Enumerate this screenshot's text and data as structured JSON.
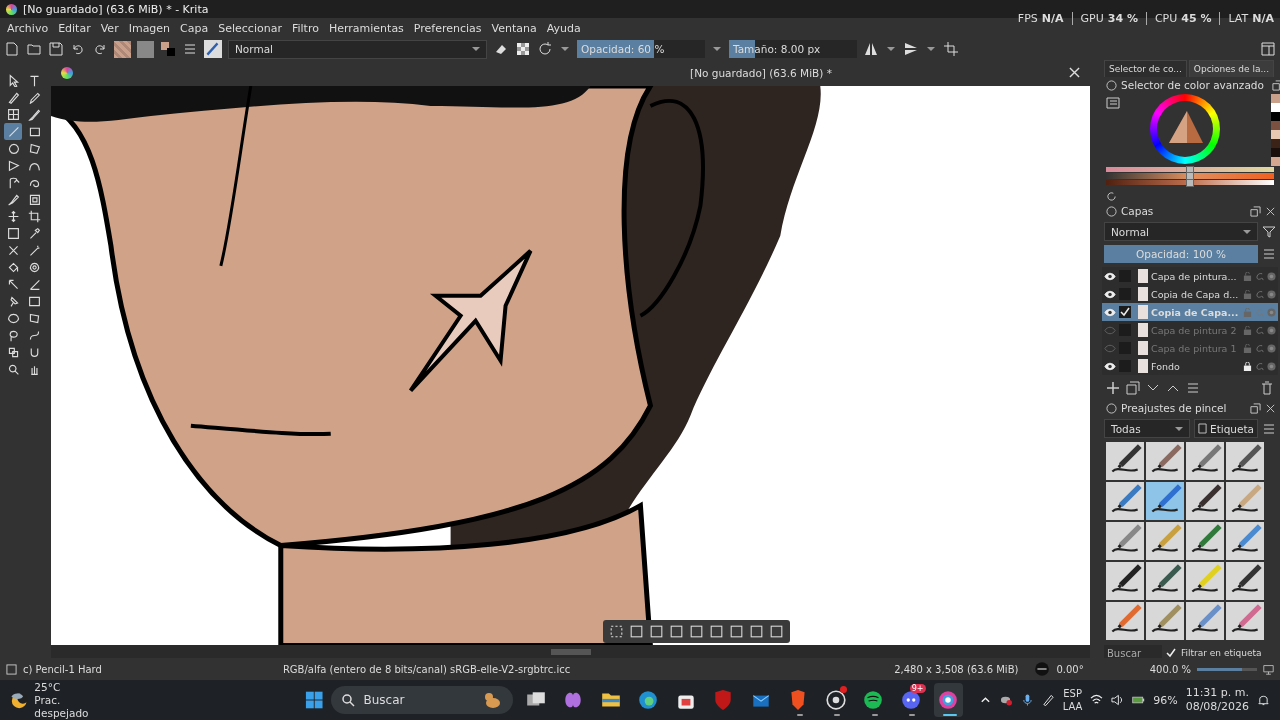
{
  "window": {
    "title": "[No guardado]  (63.6 MiB) * - Krita"
  },
  "perf": [
    {
      "label": "FPS",
      "value": "N/A"
    },
    {
      "label": "GPU",
      "value": "34 %"
    },
    {
      "label": "CPU",
      "value": "45 %"
    },
    {
      "label": "LAT",
      "value": "N/A"
    }
  ],
  "menu": [
    "Archivo",
    "Editar",
    "Ver",
    "Imagen",
    "Capa",
    "Seleccionar",
    "Filtro",
    "Herramientas",
    "Preferencias",
    "Ventana",
    "Ayuda"
  ],
  "toolbar": {
    "blend_mode": "Normal",
    "opacity": {
      "text": "Opacidad: 60 %",
      "level": 0.6
    },
    "size": {
      "text": "Tamaño: 8.00 px",
      "level": 0.2
    }
  },
  "toolbox": {
    "tools": [
      {
        "selected": false
      },
      {
        "selected": false
      },
      {
        "selected": false
      },
      {
        "selected": false
      },
      {
        "selected": false
      },
      {
        "selected": false
      },
      {
        "selected": true
      },
      {
        "selected": false
      },
      {
        "selected": false
      },
      {
        "selected": false
      },
      {
        "selected": false
      },
      {
        "selected": false
      },
      {
        "selected": false
      },
      {
        "selected": false
      },
      {
        "selected": false
      },
      {
        "selected": false
      },
      {
        "selected": false
      },
      {
        "selected": false
      },
      {
        "selected": false
      },
      {
        "selected": false
      },
      {
        "selected": false
      },
      {
        "selected": false
      },
      {
        "selected": false
      },
      {
        "selected": false
      },
      {
        "selected": false
      },
      {
        "selected": false
      },
      {
        "selected": false
      },
      {
        "selected": false
      },
      {
        "selected": false
      },
      {
        "selected": false
      },
      {
        "selected": false
      },
      {
        "selected": false
      },
      {
        "selected": false
      },
      {
        "selected": false
      },
      {
        "selected": false
      },
      {
        "selected": false
      }
    ]
  },
  "document": {
    "tab_title": "[No guardado]  (63.6 MiB) *"
  },
  "docker_tabs": [
    {
      "label": "Selector de co...",
      "selected": true
    },
    {
      "label": "Opciones de la...",
      "selected": false
    }
  ],
  "color_selector": {
    "title": "Selector de color avanzado",
    "history": [
      {
        "color": "#c9a08a"
      },
      {
        "color": "#ffffff"
      },
      {
        "color": "#000000"
      },
      {
        "color": "#7a5040"
      },
      {
        "color": "#e8c8b0"
      },
      {
        "color": "#3c2318"
      },
      {
        "color": "#1a0f0a"
      },
      {
        "color": "#d4a890"
      }
    ],
    "sliders": [
      {
        "level": 0.5
      },
      {
        "level": 0.5
      },
      {
        "level": 0.5
      }
    ]
  },
  "layers": {
    "title": "Capas",
    "blend_mode": "Normal",
    "opacity": {
      "text": "Opacidad: 100 %",
      "level": 1
    },
    "items": [
      {
        "name": "Capa de pintura...",
        "visible": true,
        "selected": false,
        "locked": false
      },
      {
        "name": "Copia de Capa d...",
        "visible": true,
        "selected": false,
        "locked": false
      },
      {
        "name": "Copia de Capa...",
        "visible": true,
        "selected": true,
        "locked": false
      },
      {
        "name": "Capa de pintura 2",
        "visible": false,
        "selected": false,
        "locked": false
      },
      {
        "name": "Capa de pintura 1",
        "visible": false,
        "selected": false,
        "locked": false
      },
      {
        "name": "Fondo",
        "visible": true,
        "selected": false,
        "locked": true
      }
    ]
  },
  "brush_presets": {
    "title": "Preajustes de pincel",
    "filter": "Todas",
    "tag": "Etiqueta",
    "search_placeholder": "Buscar",
    "filter_in_tag": {
      "label": "Filtrar en etiqueta",
      "checked": true
    },
    "presets": [
      {
        "selected": false
      },
      {
        "selected": false
      },
      {
        "selected": false
      },
      {
        "selected": false
      },
      {
        "selected": false
      },
      {
        "selected": true
      },
      {
        "selected": false
      },
      {
        "selected": false
      },
      {
        "selected": false
      },
      {
        "selected": false
      },
      {
        "selected": false
      },
      {
        "selected": false
      },
      {
        "selected": false
      },
      {
        "selected": false
      },
      {
        "selected": false
      },
      {
        "selected": false
      },
      {
        "selected": false
      },
      {
        "selected": false
      },
      {
        "selected": false
      },
      {
        "selected": false
      }
    ]
  },
  "status_bar": {
    "brush": "c) Pencil-1 Hard",
    "color_space": "RGB/alfa (entero de 8 bits/canal)  sRGB-elle-V2-srgbtrc.icc",
    "image_size": "2,480 x 3,508 (63.6 MiB)",
    "rotation": "0.00°",
    "zoom": "400.0 %",
    "zoom_level": {
      "level": 0.75
    }
  },
  "taskbar": {
    "weather": {
      "temp": "25°C",
      "desc": "Prac. despejado"
    },
    "search_placeholder": "Buscar",
    "apps": [
      {
        "kind": "taskview",
        "running": false,
        "active": false
      },
      {
        "kind": "copilot",
        "running": false,
        "active": false
      },
      {
        "kind": "explorer",
        "running": false,
        "active": false
      },
      {
        "kind": "edge",
        "running": false,
        "active": false
      },
      {
        "kind": "store",
        "running": false,
        "active": false
      },
      {
        "kind": "shield",
        "running": false,
        "active": false
      },
      {
        "kind": "mail",
        "running": false,
        "active": false
      },
      {
        "kind": "lion",
        "running": true,
        "active": false
      },
      {
        "kind": "record",
        "running": true,
        "active": false,
        "dot": true
      },
      {
        "kind": "music",
        "running": true,
        "active": false
      },
      {
        "kind": "chat",
        "running": true,
        "active": false,
        "badge": "9+"
      },
      {
        "kind": "krita",
        "running": true,
        "active": true
      }
    ],
    "language": [
      "ESP",
      "LAA"
    ],
    "battery": "96%",
    "time": "11:31 p. m.",
    "date": "08/08/2026"
  }
}
